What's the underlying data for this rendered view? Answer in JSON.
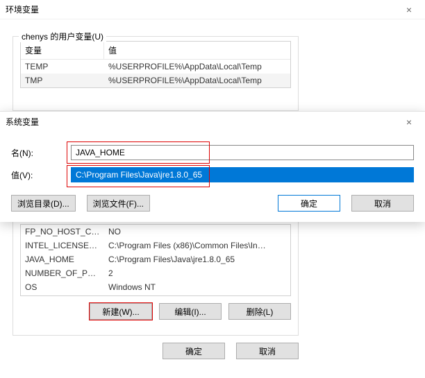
{
  "back": {
    "title": "环境变量",
    "close": "×",
    "user_group_label": "chenys 的用户变量(U)",
    "header_var": "变量",
    "header_val": "值",
    "user_rows": [
      {
        "var": "TEMP",
        "val": "%USERPROFILE%\\AppData\\Local\\Temp"
      },
      {
        "var": "TMP",
        "val": "%USERPROFILE%\\AppData\\Local\\Temp"
      }
    ],
    "sys_rows": [
      {
        "var": "FP_NO_HOST_CH…",
        "val": "NO"
      },
      {
        "var": "INTEL_LICENSE_F…",
        "val": "C:\\Program Files (x86)\\Common Files\\In…"
      },
      {
        "var": "JAVA_HOME",
        "val": "C:\\Program Files\\Java\\jre1.8.0_65"
      },
      {
        "var": "NUMBER_OF_PR…",
        "val": "2"
      },
      {
        "var": "OS",
        "val": "Windows  NT"
      }
    ],
    "btn_new": "新建(W)...",
    "btn_edit": "编辑(I)...",
    "btn_delete": "删除(L)",
    "btn_ok": "确定",
    "btn_cancel": "取消"
  },
  "front": {
    "title": "系统变量",
    "close": "×",
    "label_name": "名(N):",
    "label_value": "值(V):",
    "name_value": "JAVA_HOME",
    "value_value": "C:\\Program Files\\Java\\jre1.8.0_65",
    "btn_browse_dir": "浏览目录(D)...",
    "btn_browse_file": "浏览文件(F)...",
    "btn_ok": "确定",
    "btn_cancel": "取消"
  }
}
